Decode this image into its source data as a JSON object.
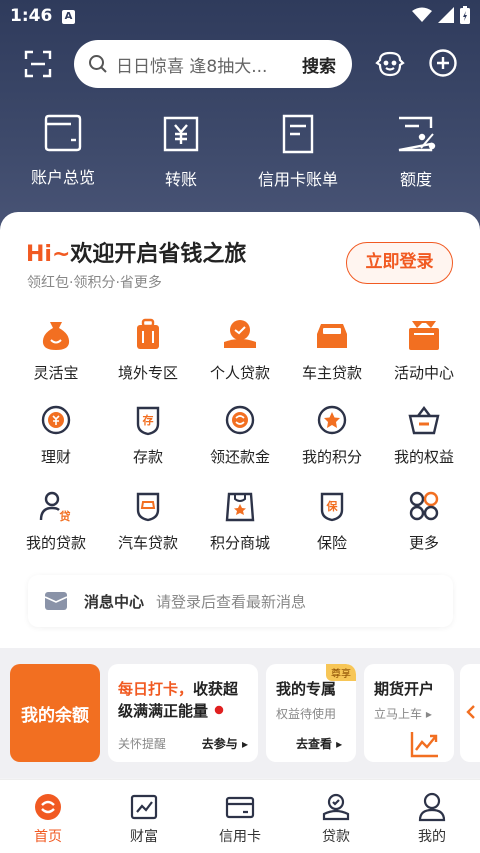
{
  "status": {
    "time": "1:46",
    "a_badge": "A"
  },
  "search": {
    "placeholder": "日日惊喜 逢8抽大...",
    "button": "搜索"
  },
  "quick": [
    {
      "label": "账户总览",
      "icon": "wallet-icon"
    },
    {
      "label": "转账",
      "icon": "transfer-icon"
    },
    {
      "label": "信用卡账单",
      "icon": "bill-icon"
    },
    {
      "label": "额度",
      "icon": "quota-icon"
    }
  ],
  "welcome": {
    "hi": "Hi~",
    "title": "欢迎开启省钱之旅",
    "sub": "领红包·领积分·省更多",
    "login": "立即登录"
  },
  "grid": [
    {
      "label": "灵活宝"
    },
    {
      "label": "境外专区"
    },
    {
      "label": "个人贷款"
    },
    {
      "label": "车主贷款"
    },
    {
      "label": "活动中心"
    },
    {
      "label": "理财"
    },
    {
      "label": "存款"
    },
    {
      "label": "领还款金"
    },
    {
      "label": "我的积分"
    },
    {
      "label": "我的权益"
    },
    {
      "label": "我的贷款"
    },
    {
      "label": "汽车贷款"
    },
    {
      "label": "积分商城"
    },
    {
      "label": "保险"
    },
    {
      "label": "更多"
    }
  ],
  "message": {
    "title": "消息中心",
    "text": "请登录后查看最新消息"
  },
  "promo": {
    "balance": "我的余额",
    "daily": {
      "line1a": "每日打卡，",
      "line1b": "收获超",
      "line2": "级满满正能量",
      "remind": "关怀提醒",
      "go": "去参与 ▸"
    },
    "vip": {
      "badge": "尊享",
      "title": "我的专属",
      "sub": "权益待使用",
      "go": "去查看 ▸"
    },
    "futures": {
      "title": "期货开户",
      "sub": "立马上车 ▸"
    }
  },
  "tabs": [
    {
      "label": "首页",
      "active": true
    },
    {
      "label": "财富"
    },
    {
      "label": "信用卡"
    },
    {
      "label": "贷款"
    },
    {
      "label": "我的"
    }
  ],
  "colors": {
    "accent": "#f15a22",
    "header": "#2f3b5c"
  }
}
